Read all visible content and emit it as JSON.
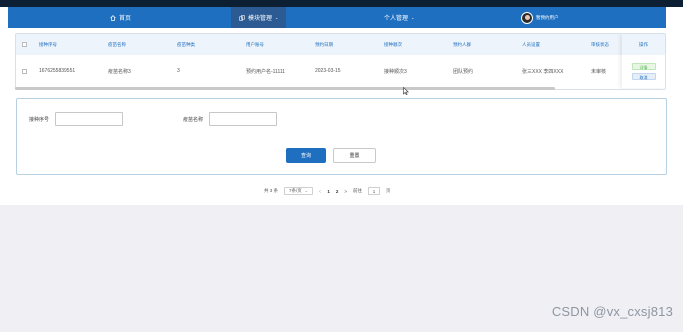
{
  "nav": {
    "home": "首页",
    "module": "模块管理",
    "personal": "个人管理",
    "user": "暂预约用户",
    "home_icon": "home-icon",
    "module_icon": "copy-icon",
    "accent": "#1f6fc0",
    "active_bg": "#2c5a93"
  },
  "table": {
    "headers": [
      "接种序号",
      "疫苗名称",
      "疫苗种类",
      "用户账号",
      "预约日期",
      "接种顺次",
      "预约人群",
      "人员设置",
      "审核状态"
    ],
    "ops_header": "操作",
    "rows": [
      {
        "cells": [
          "1676255839551",
          "疫苗名称3",
          "3",
          "预约用户名-11111",
          "2023-03-15",
          "接种顺次3",
          "团队预约",
          "张三XXX 李四XXX",
          "未审核"
        ],
        "actions": [
          "详情",
          "取消"
        ]
      }
    ]
  },
  "search": {
    "fields": [
      {
        "label": "接种序号",
        "value": ""
      },
      {
        "label": "疫苗名称",
        "value": ""
      }
    ],
    "query_label": "查询",
    "reset_label": "重置"
  },
  "pagination": {
    "total": "共 3 条",
    "page_size": "7条/页",
    "prev": "<",
    "pages": [
      "1",
      "2"
    ],
    "current_page": "2",
    "next": ">",
    "goto_label": "前往",
    "goto_value": "1",
    "page_unit": "页"
  },
  "watermark": "CSDN @vx_cxsj813"
}
